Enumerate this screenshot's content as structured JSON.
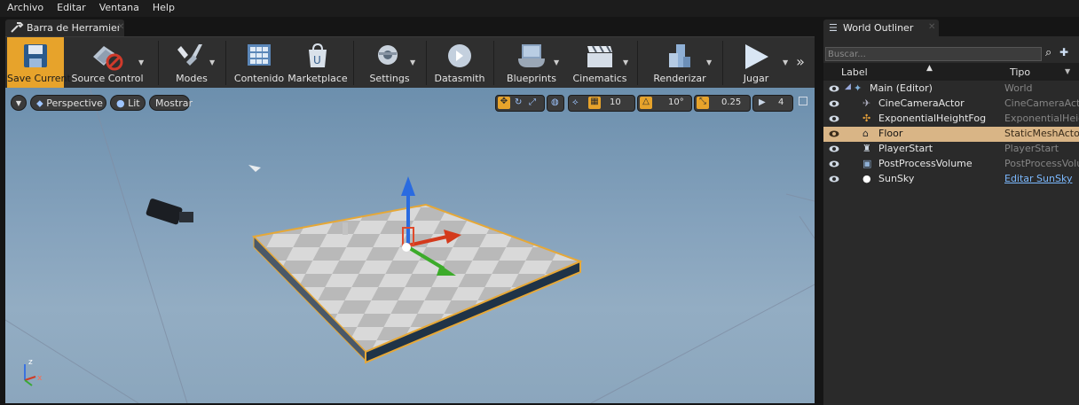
{
  "menu": [
    "Archivo",
    "Editar",
    "Ventana",
    "Help"
  ],
  "left_tab": {
    "title": "Barra de Herramientas"
  },
  "toolbar": {
    "save": "Save Current",
    "source_control": "Source Control",
    "modes": "Modes",
    "contenido": "Contenido",
    "marketplace": "Marketplace",
    "settings": "Settings",
    "datasmith": "Datasmith",
    "blueprints": "Blueprints",
    "cinematics": "Cinematics",
    "renderizar": "Renderizar",
    "jugar": "Jugar"
  },
  "viewport": {
    "perspective": "Perspective",
    "lit": "Lit",
    "mostrar": "Mostrar",
    "grid_snap": "10",
    "rotation_snap": "10°",
    "scale_snap": "0.25",
    "camera_speed": "4"
  },
  "outliner": {
    "tab_title": "World Outliner",
    "search_placeholder": "Buscar...",
    "col_label": "Label",
    "col_type": "Tipo",
    "rows": [
      {
        "label": "Main (Editor)",
        "type": "World"
      },
      {
        "label": "CineCameraActor",
        "type": "CineCameraActor"
      },
      {
        "label": "ExponentialHeightFog",
        "type": "ExponentialHeightFog"
      },
      {
        "label": "Floor",
        "type": "StaticMeshActor"
      },
      {
        "label": "PlayerStart",
        "type": "PlayerStart"
      },
      {
        "label": "PostProcessVolume",
        "type": "PostProcessVolume"
      },
      {
        "label": "SunSky",
        "type": "Editar SunSky"
      }
    ]
  },
  "colors": {
    "accent": "#e7a32b",
    "selection": "#d9b586",
    "link": "#7cb9ff"
  }
}
